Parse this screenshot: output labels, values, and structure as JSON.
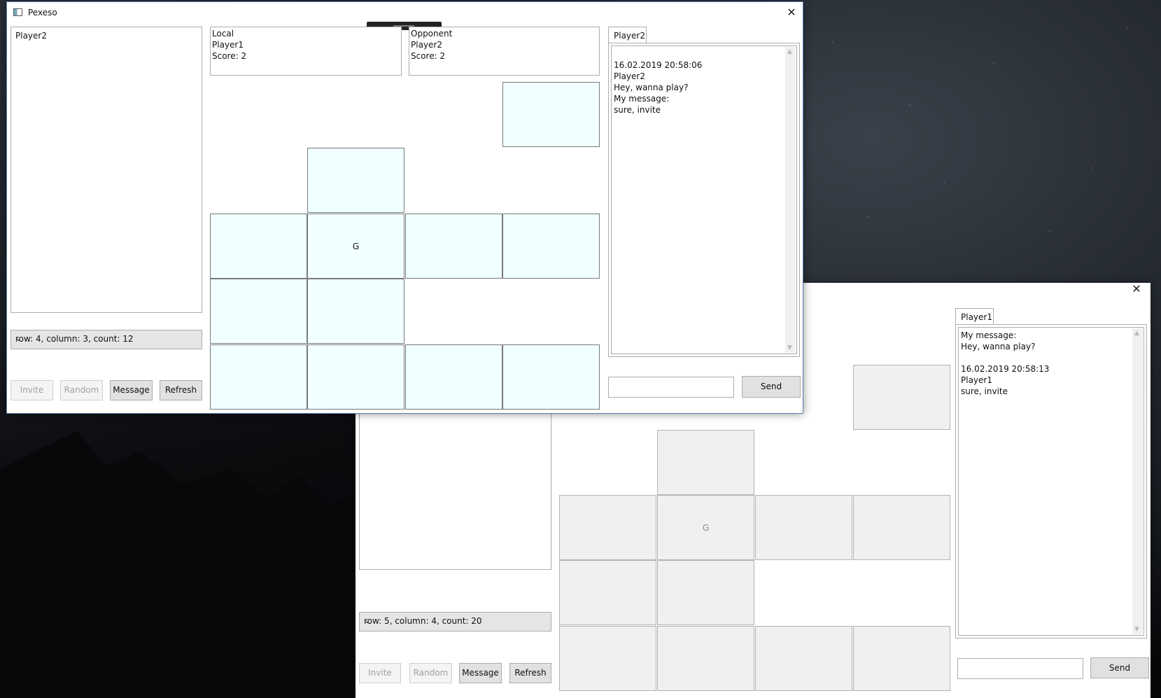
{
  "front": {
    "title": "Pexeso",
    "players_list": [
      "Player2"
    ],
    "local": {
      "label": "Local",
      "name": "Player1",
      "score": "Score: 2"
    },
    "opponent": {
      "label": "Opponent",
      "name": "Player2",
      "score": "Score: 2"
    },
    "size_select": "row: 4, column: 3, count: 12",
    "buttons": {
      "invite": "Invite",
      "random": "Random",
      "message": "Message",
      "refresh": "Refresh"
    },
    "card_text": "G",
    "chat_tab": "Player2",
    "chat_lines": [
      "",
      "16.02.2019 20:58:06",
      "Player2",
      "Hey, wanna play?",
      "My message:",
      "sure, invite"
    ],
    "send": "Send"
  },
  "back": {
    "size_select": "row: 5, column: 4, count: 20",
    "buttons": {
      "invite": "Invite",
      "random": "Random",
      "message": "Message",
      "refresh": "Refresh"
    },
    "card_text": "G",
    "chat_tab": "Player1",
    "chat_lines": [
      "My message:",
      "Hey, wanna play?",
      "",
      "16.02.2019 20:58:13",
      "Player1",
      "sure, invite"
    ],
    "send": "Send"
  },
  "icons": {
    "close": "close-icon",
    "dropdown": "chevron-down-icon",
    "app": "window-icon"
  },
  "colors": {
    "card_front": "#f0ffff",
    "card_back": "#f0f0f0",
    "button": "#e1e1e1"
  }
}
